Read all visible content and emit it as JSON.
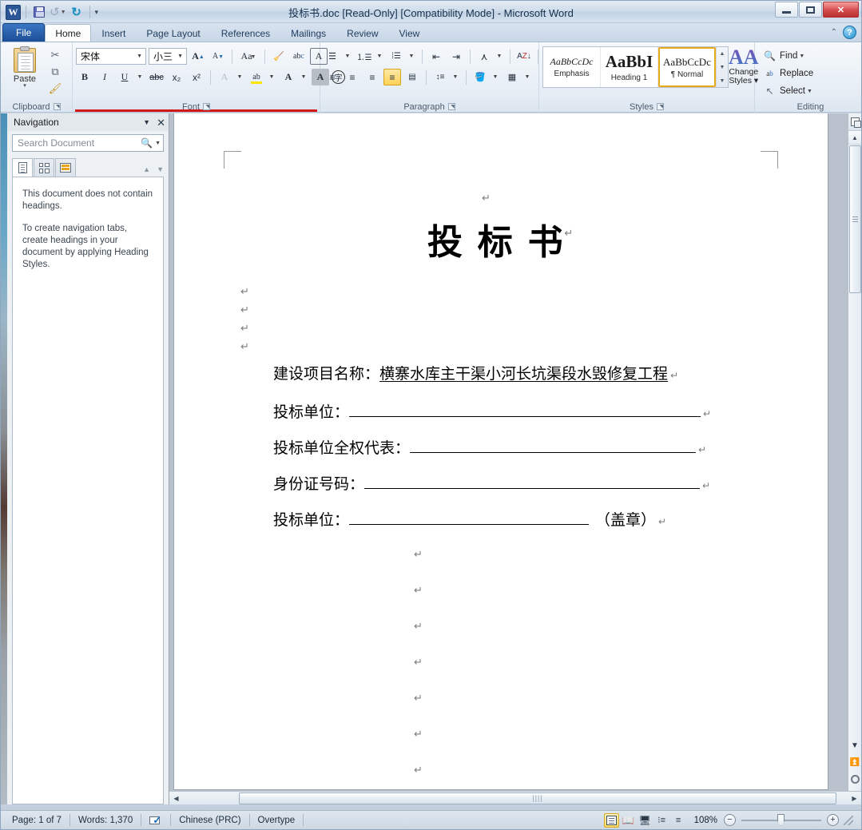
{
  "window": {
    "title": "投标书.doc [Read-Only] [Compatibility Mode]  -  Microsoft Word",
    "minimize_label": "Minimize",
    "maximize_label": "Maximize",
    "close_label": "✕"
  },
  "quick_access": {
    "app_icon": "word-logo-icon",
    "items": [
      {
        "name": "save-icon",
        "label": "Save"
      },
      {
        "name": "undo-icon",
        "label": "Undo"
      },
      {
        "name": "redo-icon",
        "label": "Redo"
      },
      {
        "name": "customize-qat-icon",
        "label": "Customize Quick Access Toolbar"
      }
    ]
  },
  "ribbon": {
    "tabs": [
      {
        "label": "File",
        "active": false,
        "style": "file"
      },
      {
        "label": "Home",
        "active": true
      },
      {
        "label": "Insert",
        "active": false
      },
      {
        "label": "Page Layout",
        "active": false
      },
      {
        "label": "References",
        "active": false
      },
      {
        "label": "Mailings",
        "active": false
      },
      {
        "label": "Review",
        "active": false
      },
      {
        "label": "View",
        "active": false
      }
    ],
    "collapse_icon": "chevron-up-icon",
    "help_label": "?",
    "groups": {
      "clipboard": {
        "label": "Clipboard",
        "paste_label": "Paste",
        "cut_label": "Cut",
        "copy_label": "Copy",
        "format_painter_label": "Format Painter"
      },
      "font": {
        "label": "Font",
        "font_name": "宋体",
        "font_size": "小三",
        "grow_label": "Grow Font",
        "shrink_label": "Shrink Font",
        "change_case_label": "Change Case",
        "clear_formatting_label": "Clear Formatting",
        "phonetic_label": "Phonetic Guide",
        "char_border_label": "Character Border",
        "bold_label": "B",
        "italic_label": "I",
        "underline_label": "U",
        "strikethrough_label": "abc",
        "subscript_label": "x₂",
        "superscript_label": "x²",
        "text_effects_label": "A",
        "highlight_label": "ab",
        "font_color_label": "A",
        "char_shading_label": "A",
        "enclose_label": "字"
      },
      "paragraph": {
        "label": "Paragraph",
        "bullets_label": "Bullets",
        "numbering_label": "Numbering",
        "multilevel_label": "Multilevel List",
        "decrease_indent_label": "Decrease Indent",
        "increase_indent_label": "Increase Indent",
        "asian_layout_label": "Asian Layout",
        "sort_label": "Sort",
        "show_marks_label": "Show/Hide ¶",
        "align_left_label": "Align Left",
        "align_center_label": "Center",
        "align_right_label": "Align Right",
        "justify_label": "Justify",
        "distribute_label": "Distributed",
        "line_spacing_label": "Line Spacing",
        "shading_label": "Shading",
        "borders_label": "Borders"
      },
      "styles": {
        "label": "Styles",
        "items": [
          {
            "preview": "AaBbCcDc",
            "name": "Emphasis",
            "selected": false
          },
          {
            "preview": "AaBbI",
            "name": "Heading 1",
            "selected": false
          },
          {
            "preview": "AaBbCcDc",
            "name": "¶ Normal",
            "selected": true
          }
        ],
        "change_styles_line1": "Change",
        "change_styles_line2": "Styles ▾"
      },
      "editing": {
        "label": "Editing",
        "find_label": "Find",
        "replace_label": "Replace",
        "select_label": "Select"
      }
    }
  },
  "navigation_pane": {
    "title": "Navigation",
    "collapse_icon": "chevron-down-icon",
    "close_icon": "close-icon",
    "search_placeholder": "Search Document",
    "search_value": "",
    "search_icon": "search-icon",
    "tabs": [
      {
        "name": "browse-headings-tab",
        "active": true
      },
      {
        "name": "browse-pages-tab",
        "active": false
      },
      {
        "name": "browse-results-tab",
        "active": false
      }
    ],
    "prev_icon": "arrow-up-icon",
    "next_icon": "arrow-down-icon",
    "empty_message_1": "This document does not contain headings.",
    "empty_message_2": "To create navigation tabs, create headings in your document by applying Heading Styles."
  },
  "document": {
    "title": "投  标  书",
    "paragraph_mark": "↵",
    "empty_marks_upper": 4,
    "form_lines": [
      {
        "label": "建设项目名称：",
        "value": "横寨水库主干渠小河长坑渠段水毁修复工程",
        "suffix": "",
        "blank": false
      },
      {
        "label": "投标单位：",
        "value": "",
        "suffix": "",
        "blank": true,
        "blank_width": 440
      },
      {
        "label": "投标单位全权代表：",
        "value": "",
        "suffix": "",
        "blank": true,
        "blank_width": 358
      },
      {
        "label": "身份证号码：",
        "value": "",
        "suffix": "",
        "blank": true,
        "blank_width": 420
      },
      {
        "label": "投标单位：",
        "value": "",
        "suffix": "（盖章）",
        "blank": true,
        "blank_width": 300
      }
    ],
    "empty_marks_lower": 7
  },
  "scrollbars": {
    "split_icon": "split-window-icon",
    "scroll_up_icon": "scroll-up-icon",
    "scroll_down_icon": "scroll-down-icon",
    "previous_page_icon": "previous-page-icon",
    "select_browse_object_icon": "select-browse-object-icon",
    "next_page_icon": "next-page-icon",
    "scroll_left_icon": "scroll-left-icon",
    "scroll_right_icon": "scroll-right-icon"
  },
  "status_bar": {
    "page": "Page: 1 of 7",
    "words": "Words: 1,370",
    "proofing_icon": "spell-check-icon",
    "language": "Chinese (PRC)",
    "overtype": "Overtype",
    "view_buttons": [
      {
        "name": "print-layout-view",
        "active": true
      },
      {
        "name": "full-screen-reading-view",
        "active": false
      },
      {
        "name": "web-layout-view",
        "active": false
      },
      {
        "name": "outline-view",
        "active": false
      },
      {
        "name": "draft-view",
        "active": false
      }
    ],
    "zoom": "108%",
    "zoom_out_label": "−",
    "zoom_in_label": "+"
  }
}
